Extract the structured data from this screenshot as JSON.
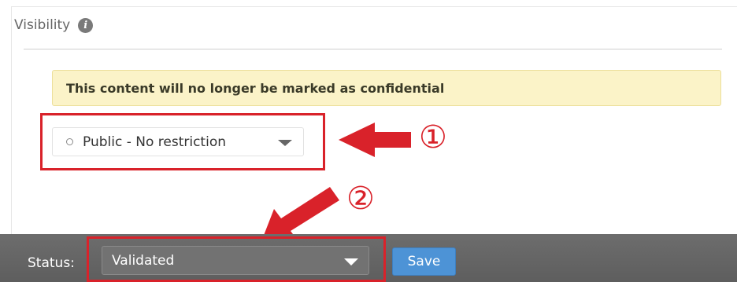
{
  "visibility": {
    "title": "Visibility",
    "info_icon_glyph": "i",
    "notice": "This content will no longer be marked as confidential",
    "selected_option": "Public - No restriction"
  },
  "annotations": {
    "step1_label": "①",
    "step2_label": "②",
    "color": "#d9222a"
  },
  "status_bar": {
    "label": "Status:",
    "selected_status": "Validated",
    "save_label": "Save"
  },
  "colors": {
    "notice_background": "#fbf3c8",
    "status_bar_background": "#646464",
    "save_button": "#4d93d6"
  }
}
